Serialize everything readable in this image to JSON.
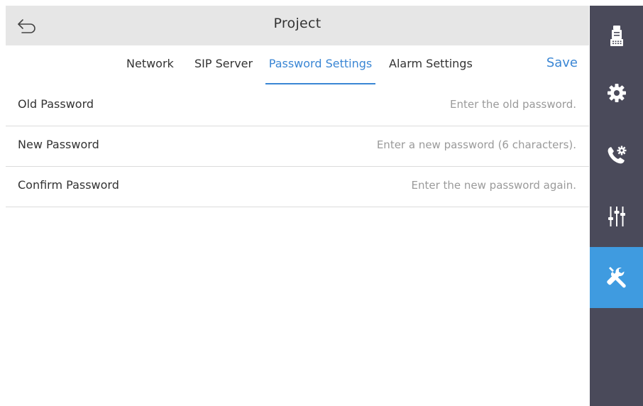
{
  "header": {
    "title": "Project",
    "back_icon": "back-arrow-icon"
  },
  "tabs": [
    {
      "label": "Network",
      "active": false
    },
    {
      "label": "SIP Server",
      "active": false
    },
    {
      "label": "Password Settings",
      "active": true
    },
    {
      "label": "Alarm Settings",
      "active": false
    }
  ],
  "toolbar": {
    "save_label": "Save"
  },
  "form": {
    "rows": [
      {
        "label": "Old Password",
        "value": "",
        "placeholder": "Enter the old password."
      },
      {
        "label": "New Password",
        "value": "",
        "placeholder": "Enter a new password (6 characters)."
      },
      {
        "label": "Confirm Password",
        "value": "",
        "placeholder": "Enter the new password again."
      }
    ]
  },
  "sidebar": {
    "items": [
      {
        "icon": "intercom-device-icon",
        "active": false
      },
      {
        "icon": "gear-icon",
        "active": false
      },
      {
        "icon": "call-settings-icon",
        "active": false
      },
      {
        "icon": "sliders-icon",
        "active": false
      },
      {
        "icon": "tools-icon",
        "active": true
      }
    ]
  },
  "colors": {
    "accent": "#3a86d4",
    "sidebar_bg": "#4a4a5a",
    "sidebar_active": "#3f9be0",
    "titlebar_bg": "#e6e6e6"
  }
}
